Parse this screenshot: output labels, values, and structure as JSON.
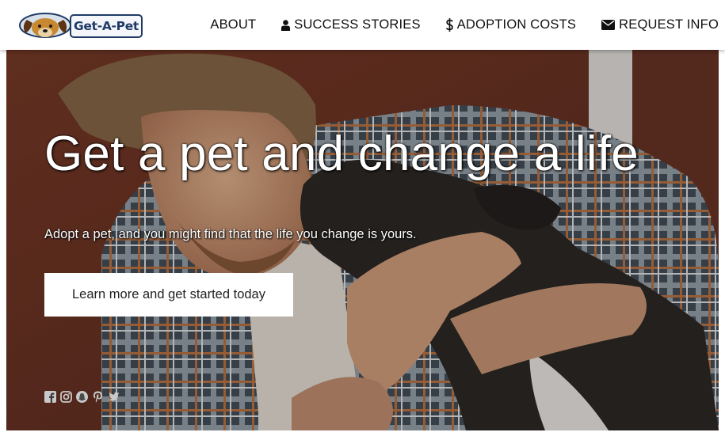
{
  "brand": {
    "name": "Get-A-Pet",
    "color": "#1f3a66"
  },
  "nav": {
    "items": [
      {
        "label": "ABOUT",
        "icon": ""
      },
      {
        "label": "SUCCESS STORIES",
        "icon": "user-icon"
      },
      {
        "label": "ADOPTION COSTS",
        "icon": "dollar-icon"
      },
      {
        "label": "REQUEST INFO",
        "icon": "envelope-icon"
      }
    ]
  },
  "hero": {
    "title": "Get a pet and change a life",
    "subtitle": "Adopt a pet, and you might find that the life you change is yours.",
    "cta_label": "Learn more and get started today"
  },
  "social": {
    "icons": [
      "facebook-icon",
      "instagram-icon",
      "snapchat-icon",
      "pinterest-icon",
      "twitter-icon"
    ]
  }
}
